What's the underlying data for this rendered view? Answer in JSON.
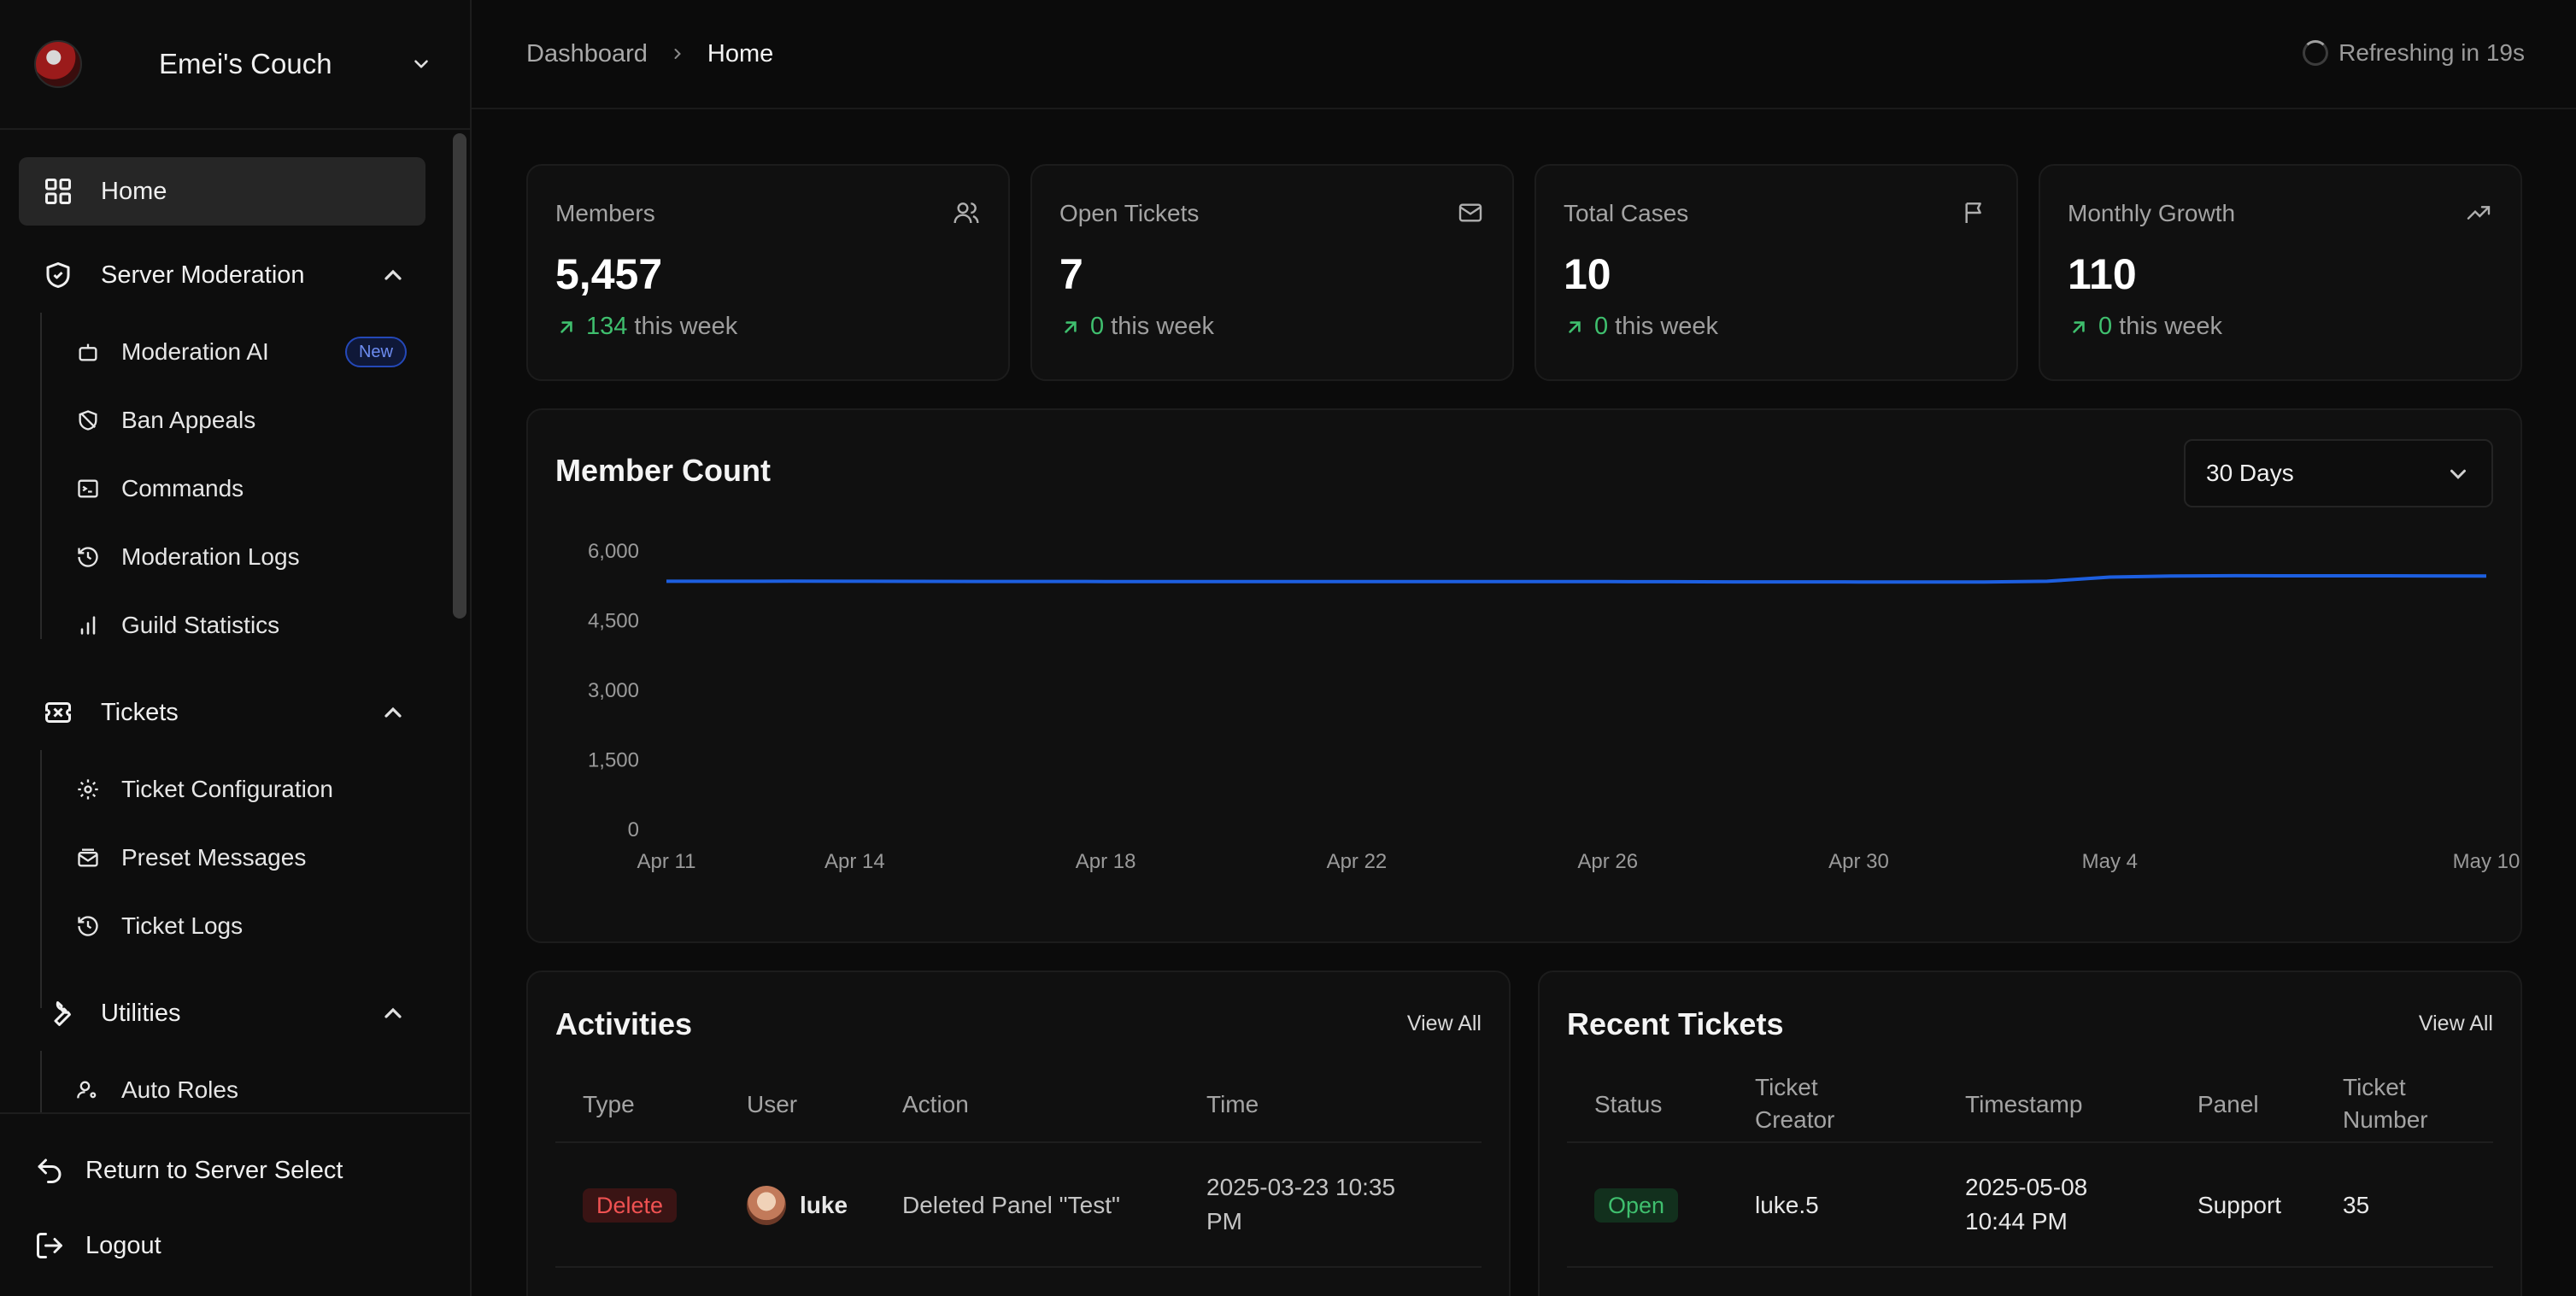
{
  "sidebar": {
    "server_name": "Emei's Couch",
    "home_label": "Home",
    "groups": [
      {
        "label": "Server Moderation",
        "icon": "shield-icon",
        "items": [
          {
            "label": "Moderation AI",
            "icon": "bot-icon",
            "badge": "New"
          },
          {
            "label": "Ban Appeals",
            "icon": "shield-off-icon"
          },
          {
            "label": "Commands",
            "icon": "terminal-icon"
          },
          {
            "label": "Moderation Logs",
            "icon": "history-icon"
          },
          {
            "label": "Guild Statistics",
            "icon": "bar-chart-icon"
          }
        ]
      },
      {
        "label": "Tickets",
        "icon": "ticket-icon",
        "items": [
          {
            "label": "Ticket Configuration",
            "icon": "gear-icon"
          },
          {
            "label": "Preset Messages",
            "icon": "mail-stack-icon"
          },
          {
            "label": "Ticket Logs",
            "icon": "history-icon"
          }
        ]
      },
      {
        "label": "Utilities",
        "icon": "wrench-icon",
        "items": [
          {
            "label": "Auto Roles",
            "icon": "user-cog-icon"
          }
        ]
      }
    ],
    "footer": {
      "return_label": "Return to Server Select",
      "logout_label": "Logout"
    }
  },
  "topbar": {
    "breadcrumb": [
      "Dashboard",
      "Home"
    ],
    "refresh_text": "Refreshing in 19s"
  },
  "stats": [
    {
      "title": "Members",
      "value": "5,457",
      "delta": "134",
      "suffix": "this week",
      "icon": "users-icon"
    },
    {
      "title": "Open Tickets",
      "value": "7",
      "delta": "0",
      "suffix": "this week",
      "icon": "mail-icon"
    },
    {
      "title": "Total Cases",
      "value": "10",
      "delta": "0",
      "suffix": "this week",
      "icon": "flag-icon"
    },
    {
      "title": "Monthly Growth",
      "value": "110",
      "delta": "0",
      "suffix": "this week",
      "icon": "trending-up-icon"
    }
  ],
  "member_chart": {
    "title": "Member Count",
    "range": "30 Days"
  },
  "chart_data": {
    "type": "line",
    "title": "Member Count",
    "series": [
      {
        "values": [
          5330,
          5330,
          5332,
          5330,
          5328,
          5326,
          5326,
          5325,
          5324,
          5325,
          5325,
          5324,
          5324,
          5323,
          5324,
          5322,
          5320,
          5318,
          5317,
          5316,
          5316,
          5316,
          5330,
          5420,
          5445,
          5450,
          5448,
          5447,
          5446,
          5445
        ]
      }
    ],
    "x_start": "Apr 11",
    "x_tick_labels": [
      "Apr 11",
      "Apr 14",
      "Apr 18",
      "Apr 22",
      "Apr 26",
      "Apr 30",
      "May 4",
      "May 10"
    ],
    "x_tick_index": [
      0,
      3,
      7,
      11,
      15,
      19,
      23,
      29
    ],
    "y_ticks": [
      "6,000",
      "4,500",
      "3,000",
      "1,500",
      "0"
    ],
    "y_tick_values": [
      6000,
      4500,
      3000,
      1500,
      0
    ],
    "ylim": [
      0,
      6000
    ],
    "color": "#1d5fe0",
    "grid": false
  },
  "activities": {
    "title": "Activities",
    "view_all": "View All",
    "columns": [
      "Type",
      "User",
      "Action",
      "Time"
    ],
    "rows": [
      {
        "type": "Delete",
        "user": "luke",
        "action": "Deleted Panel \"Test\"",
        "time_line1": "2025-03-23 10:35",
        "time_line2": "PM"
      }
    ]
  },
  "tickets": {
    "title": "Recent Tickets",
    "view_all": "View All",
    "columns": [
      [
        "Status"
      ],
      [
        "Ticket",
        "Creator"
      ],
      [
        "Timestamp"
      ],
      [
        "Panel"
      ],
      [
        "Ticket",
        "Number"
      ]
    ],
    "rows": [
      {
        "status": "Open",
        "creator": "luke.5",
        "ts_line1": "2025-05-08",
        "ts_line2": "10:44 PM",
        "panel": "Support",
        "number": "35"
      }
    ]
  },
  "colors": {
    "accent": "#1d5fe0",
    "positive": "#3fbf6e",
    "danger": "#f05252",
    "badge_new": "#2448b8"
  }
}
